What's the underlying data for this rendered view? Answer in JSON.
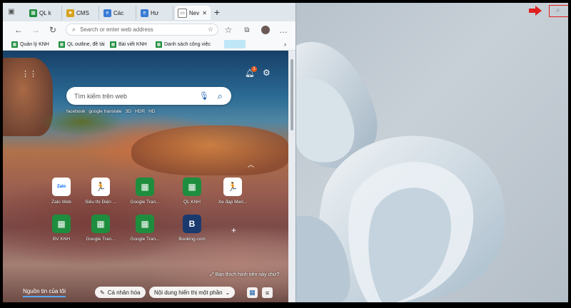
{
  "browser": {
    "tabs": [
      {
        "label": "QL k",
        "icon": "sheets-icon",
        "color": "#1e8e3e"
      },
      {
        "label": "CMS",
        "icon": "cms-icon",
        "color": "#d7a31f"
      },
      {
        "label": "Các",
        "icon": "edge-icon",
        "color": "#3a7bd5"
      },
      {
        "label": "Hư",
        "icon": "edge-icon",
        "color": "#3a7bd5"
      },
      {
        "label": "Nev",
        "icon": "newtab-icon",
        "color": "#555555"
      }
    ],
    "address_placeholder": "Search or enter web address",
    "bookmarks": [
      {
        "label": "Quản lý KNH"
      },
      {
        "label": "QL outline, đề tài"
      },
      {
        "label": "Bài viết KNH"
      },
      {
        "label": "Danh sách công việc"
      }
    ]
  },
  "newtab": {
    "search_placeholder": "Tìm kiếm trên web",
    "quicklinks": [
      "facebook",
      "google translate",
      "3D",
      "HDR",
      "HD"
    ],
    "notification_count": "1",
    "tiles": [
      {
        "label": "Zalo Web",
        "icon": "zalo-icon",
        "glyph": "Zalo",
        "color": "#0068ff"
      },
      {
        "label": "Siêu thị Điện ...",
        "icon": "running-icon",
        "glyph": "🏃",
        "color": "#1a73e8"
      },
      {
        "label": "Google Tran...",
        "icon": "sheets-icon",
        "glyph": "▦",
        "color": "#1e8e3e"
      },
      {
        "label": "QL KNH",
        "icon": "sheets-icon",
        "glyph": "▦",
        "color": "#1e8e3e"
      },
      {
        "label": "Xe đạp Meri...",
        "icon": "running-icon",
        "glyph": "🏃",
        "color": "#1a73e8"
      },
      {
        "label": "BV KNH",
        "icon": "sheets-icon",
        "glyph": "▦",
        "color": "#1e8e3e"
      },
      {
        "label": "Google Tran...",
        "icon": "sheets-icon",
        "glyph": "▦",
        "color": "#1e8e3e"
      },
      {
        "label": "Google Tran...",
        "icon": "sheets-icon",
        "glyph": "▦",
        "color": "#1e8e3e"
      },
      {
        "label": "Booking.com",
        "icon": "booking-icon",
        "glyph": "B",
        "color": "#1a3a6e"
      }
    ],
    "like_background": "Bạn thích hình nền này chứ?",
    "feed_tab": "Nguồn tin của tôi",
    "personalize": "Cá nhân hóa",
    "content_visible": "Nội dung hiển thị một phần"
  }
}
